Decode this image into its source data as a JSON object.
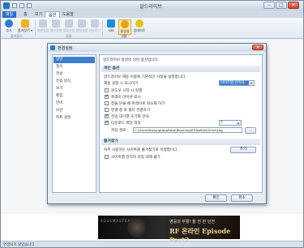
{
  "app": {
    "title": "알드라이브",
    "tabs": [
      "파일",
      "홈",
      "보기",
      "옵션",
      "도움말"
    ],
    "ribbon": {
      "buttons": [
        {
          "label": "추가",
          "color": "#2e7bd0"
        },
        {
          "label": "즐겨찾기 ▾",
          "color": "#f0b429"
        },
        {
          "label": "정렬설정",
          "color": "#b8c4d2"
        },
        {
          "label": "열기정렬",
          "color": "#b8c4d2"
        },
        {
          "label": "정렬순정",
          "color": "#b8c4d2"
        },
        {
          "label": "컬럼설정",
          "color": "#b8c4d2"
        },
        {
          "label": "기본로그",
          "color": "#b8c4d2"
        },
        {
          "label": "서버",
          "color": "#1f8bd6"
        },
        {
          "label": "환경설정",
          "color": "#e8a317"
        },
        {
          "label": "업데이트",
          "color": "#e2c21a"
        }
      ],
      "groups": [
        "즐겨찾기",
        "정렬",
        "설정"
      ]
    },
    "status": "연결되지 않았습니다.",
    "ad": {
      "brand": "SOULMASTERS",
      "line1": "영웅의 부활! 돌 전 본 던전",
      "line2": "RF 온라인 Episode Part2"
    }
  },
  "dialog": {
    "title": "환경설정",
    "close": "X",
    "nav": [
      "일반",
      "접속",
      "전송",
      "전송 방식",
      "보기",
      "편집",
      "언어",
      "보안",
      "파트 설정"
    ],
    "header_desc": "알드라이브 동작의 일반 옵션입니다.",
    "sections": {
      "general": {
        "title": "개인 옵션",
        "desc": "알드라이브 재동 이름에 기본적인 사항을 설정합니다.",
        "startup_label": "재동 설정 시 표시하기",
        "startup_value": "사이트맵 관리자",
        "options": [
          {
            "label": "윈도우 시작 시 실행",
            "checked": false
          },
          {
            "label": "트레이 아이콘 표시",
            "checked": true
          },
          {
            "label": "창을 닫을 때 트레이로 최소화 하기",
            "checked": false
          },
          {
            "label": "연결 창 로 폴더 연결하기",
            "checked": false
          },
          {
            "label": "전송 대기열 초기화 안내",
            "checked": true
          },
          {
            "label": "다운로드 파일 저장",
            "checked": true
          }
        ],
        "download_count": "7",
        "save_path_label": "저장 경로 :",
        "save_path_value": "C:\\Users\\Hwjung\\AppData\\Roaming\\ESTsoft\\ALDrive\\Log",
        "browse_label": "..."
      },
      "favorites": {
        "title": "즐겨찾기",
        "desc": "자주 사용하는 사이트를 즐겨찾기로 지정합니다.",
        "add_label": "추가",
        "option_label": "사이트맵 관리자 자동 대재 불기",
        "option_checked": false
      }
    },
    "ok_label": "확인",
    "cancel_label": "취소"
  }
}
